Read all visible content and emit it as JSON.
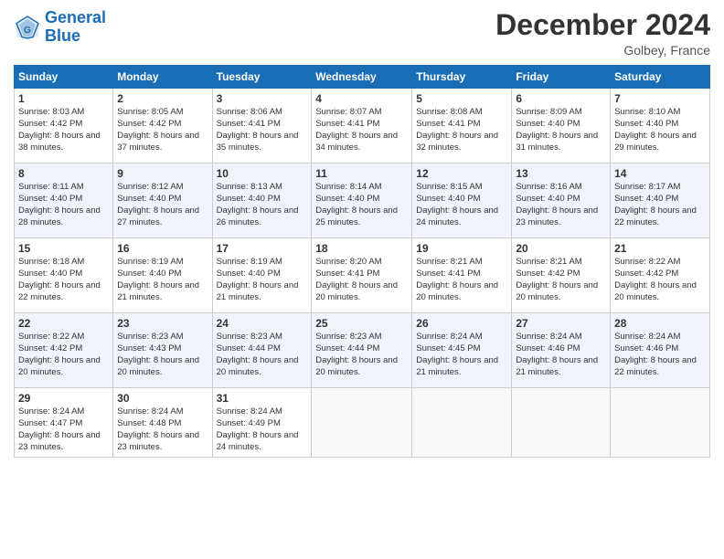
{
  "header": {
    "logo_line1": "General",
    "logo_line2": "Blue",
    "month_title": "December 2024",
    "location": "Golbey, France"
  },
  "weekdays": [
    "Sunday",
    "Monday",
    "Tuesday",
    "Wednesday",
    "Thursday",
    "Friday",
    "Saturday"
  ],
  "weeks": [
    [
      {
        "day": "1",
        "sunrise": "Sunrise: 8:03 AM",
        "sunset": "Sunset: 4:42 PM",
        "daylight": "Daylight: 8 hours and 38 minutes."
      },
      {
        "day": "2",
        "sunrise": "Sunrise: 8:05 AM",
        "sunset": "Sunset: 4:42 PM",
        "daylight": "Daylight: 8 hours and 37 minutes."
      },
      {
        "day": "3",
        "sunrise": "Sunrise: 8:06 AM",
        "sunset": "Sunset: 4:41 PM",
        "daylight": "Daylight: 8 hours and 35 minutes."
      },
      {
        "day": "4",
        "sunrise": "Sunrise: 8:07 AM",
        "sunset": "Sunset: 4:41 PM",
        "daylight": "Daylight: 8 hours and 34 minutes."
      },
      {
        "day": "5",
        "sunrise": "Sunrise: 8:08 AM",
        "sunset": "Sunset: 4:41 PM",
        "daylight": "Daylight: 8 hours and 32 minutes."
      },
      {
        "day": "6",
        "sunrise": "Sunrise: 8:09 AM",
        "sunset": "Sunset: 4:40 PM",
        "daylight": "Daylight: 8 hours and 31 minutes."
      },
      {
        "day": "7",
        "sunrise": "Sunrise: 8:10 AM",
        "sunset": "Sunset: 4:40 PM",
        "daylight": "Daylight: 8 hours and 29 minutes."
      }
    ],
    [
      {
        "day": "8",
        "sunrise": "Sunrise: 8:11 AM",
        "sunset": "Sunset: 4:40 PM",
        "daylight": "Daylight: 8 hours and 28 minutes."
      },
      {
        "day": "9",
        "sunrise": "Sunrise: 8:12 AM",
        "sunset": "Sunset: 4:40 PM",
        "daylight": "Daylight: 8 hours and 27 minutes."
      },
      {
        "day": "10",
        "sunrise": "Sunrise: 8:13 AM",
        "sunset": "Sunset: 4:40 PM",
        "daylight": "Daylight: 8 hours and 26 minutes."
      },
      {
        "day": "11",
        "sunrise": "Sunrise: 8:14 AM",
        "sunset": "Sunset: 4:40 PM",
        "daylight": "Daylight: 8 hours and 25 minutes."
      },
      {
        "day": "12",
        "sunrise": "Sunrise: 8:15 AM",
        "sunset": "Sunset: 4:40 PM",
        "daylight": "Daylight: 8 hours and 24 minutes."
      },
      {
        "day": "13",
        "sunrise": "Sunrise: 8:16 AM",
        "sunset": "Sunset: 4:40 PM",
        "daylight": "Daylight: 8 hours and 23 minutes."
      },
      {
        "day": "14",
        "sunrise": "Sunrise: 8:17 AM",
        "sunset": "Sunset: 4:40 PM",
        "daylight": "Daylight: 8 hours and 22 minutes."
      }
    ],
    [
      {
        "day": "15",
        "sunrise": "Sunrise: 8:18 AM",
        "sunset": "Sunset: 4:40 PM",
        "daylight": "Daylight: 8 hours and 22 minutes."
      },
      {
        "day": "16",
        "sunrise": "Sunrise: 8:19 AM",
        "sunset": "Sunset: 4:40 PM",
        "daylight": "Daylight: 8 hours and 21 minutes."
      },
      {
        "day": "17",
        "sunrise": "Sunrise: 8:19 AM",
        "sunset": "Sunset: 4:40 PM",
        "daylight": "Daylight: 8 hours and 21 minutes."
      },
      {
        "day": "18",
        "sunrise": "Sunrise: 8:20 AM",
        "sunset": "Sunset: 4:41 PM",
        "daylight": "Daylight: 8 hours and 20 minutes."
      },
      {
        "day": "19",
        "sunrise": "Sunrise: 8:21 AM",
        "sunset": "Sunset: 4:41 PM",
        "daylight": "Daylight: 8 hours and 20 minutes."
      },
      {
        "day": "20",
        "sunrise": "Sunrise: 8:21 AM",
        "sunset": "Sunset: 4:42 PM",
        "daylight": "Daylight: 8 hours and 20 minutes."
      },
      {
        "day": "21",
        "sunrise": "Sunrise: 8:22 AM",
        "sunset": "Sunset: 4:42 PM",
        "daylight": "Daylight: 8 hours and 20 minutes."
      }
    ],
    [
      {
        "day": "22",
        "sunrise": "Sunrise: 8:22 AM",
        "sunset": "Sunset: 4:42 PM",
        "daylight": "Daylight: 8 hours and 20 minutes."
      },
      {
        "day": "23",
        "sunrise": "Sunrise: 8:23 AM",
        "sunset": "Sunset: 4:43 PM",
        "daylight": "Daylight: 8 hours and 20 minutes."
      },
      {
        "day": "24",
        "sunrise": "Sunrise: 8:23 AM",
        "sunset": "Sunset: 4:44 PM",
        "daylight": "Daylight: 8 hours and 20 minutes."
      },
      {
        "day": "25",
        "sunrise": "Sunrise: 8:23 AM",
        "sunset": "Sunset: 4:44 PM",
        "daylight": "Daylight: 8 hours and 20 minutes."
      },
      {
        "day": "26",
        "sunrise": "Sunrise: 8:24 AM",
        "sunset": "Sunset: 4:45 PM",
        "daylight": "Daylight: 8 hours and 21 minutes."
      },
      {
        "day": "27",
        "sunrise": "Sunrise: 8:24 AM",
        "sunset": "Sunset: 4:46 PM",
        "daylight": "Daylight: 8 hours and 21 minutes."
      },
      {
        "day": "28",
        "sunrise": "Sunrise: 8:24 AM",
        "sunset": "Sunset: 4:46 PM",
        "daylight": "Daylight: 8 hours and 22 minutes."
      }
    ],
    [
      {
        "day": "29",
        "sunrise": "Sunrise: 8:24 AM",
        "sunset": "Sunset: 4:47 PM",
        "daylight": "Daylight: 8 hours and 23 minutes."
      },
      {
        "day": "30",
        "sunrise": "Sunrise: 8:24 AM",
        "sunset": "Sunset: 4:48 PM",
        "daylight": "Daylight: 8 hours and 23 minutes."
      },
      {
        "day": "31",
        "sunrise": "Sunrise: 8:24 AM",
        "sunset": "Sunset: 4:49 PM",
        "daylight": "Daylight: 8 hours and 24 minutes."
      },
      null,
      null,
      null,
      null
    ]
  ]
}
